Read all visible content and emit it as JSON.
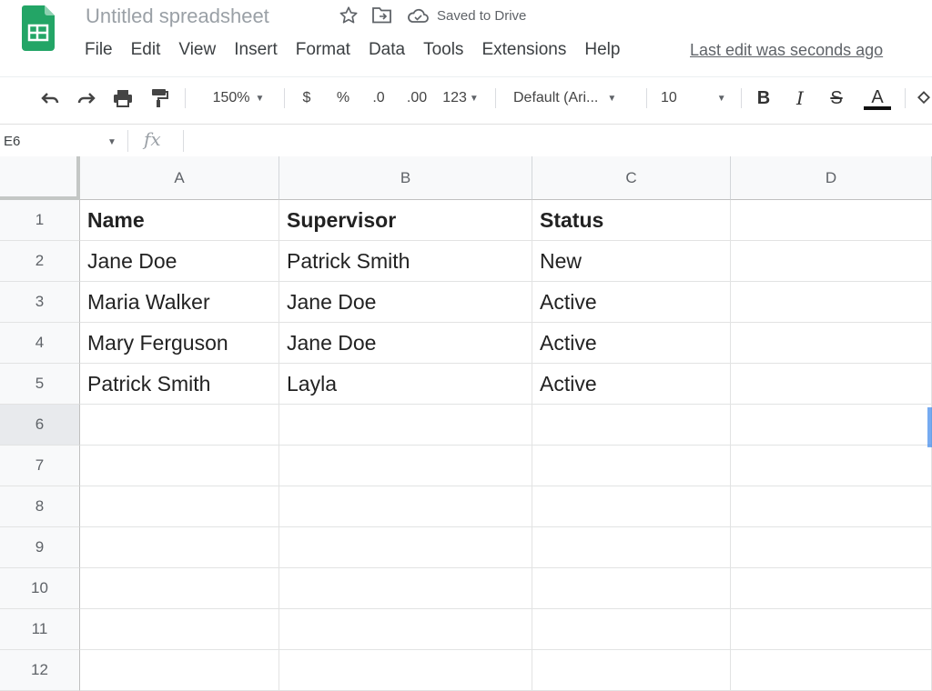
{
  "header": {
    "title": "Untitled spreadsheet",
    "saved_status": "Saved to Drive",
    "last_edit": "Last edit was seconds ago",
    "menu": [
      "File",
      "Edit",
      "View",
      "Insert",
      "Format",
      "Data",
      "Tools",
      "Extensions",
      "Help"
    ]
  },
  "toolbar": {
    "zoom": "150%",
    "currency": "$",
    "percent": "%",
    "decrease_decimal": ".0",
    "increase_decimal": ".00",
    "more_formats": "123",
    "font": "Default (Ari...",
    "font_size": "10",
    "bold": "B",
    "italic": "I",
    "strikethrough": "S",
    "text_color": "A"
  },
  "formula_bar": {
    "cell_ref": "E6",
    "fx": "fx",
    "value": ""
  },
  "sheet": {
    "columns": [
      "A",
      "B",
      "C",
      "D"
    ],
    "rows": [
      "1",
      "2",
      "3",
      "4",
      "5",
      "6",
      "7",
      "8",
      "9",
      "10",
      "11",
      "12"
    ],
    "selected_row": "6",
    "cells": [
      [
        "Name",
        "Supervisor",
        "Status",
        ""
      ],
      [
        "Jane Doe",
        "Patrick Smith",
        "New",
        ""
      ],
      [
        "Maria Walker",
        "Jane Doe",
        "Active",
        ""
      ],
      [
        "Mary Ferguson",
        "Jane Doe",
        "Active",
        ""
      ],
      [
        "Patrick Smith",
        "Layla",
        "Active",
        ""
      ]
    ]
  },
  "colors": {
    "brand_green": "#0f9d58",
    "selection_blue": "#1a73e8"
  }
}
